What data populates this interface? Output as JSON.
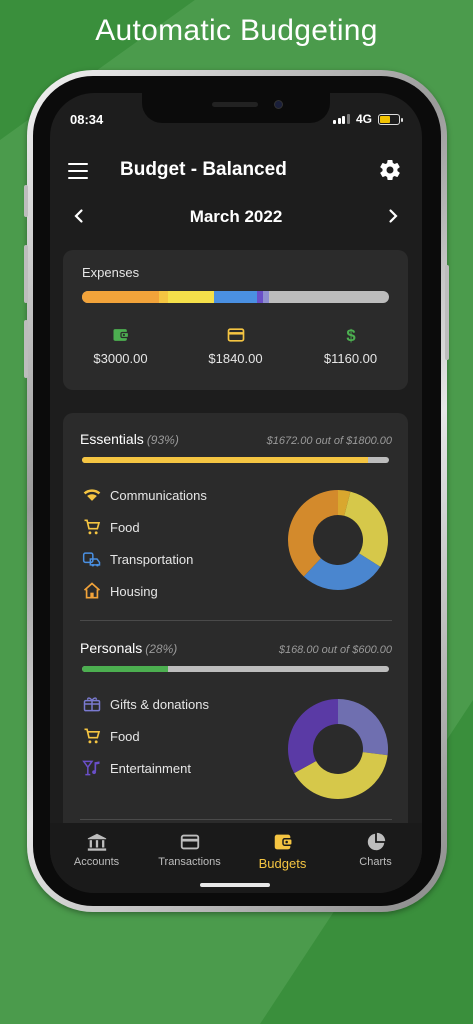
{
  "headline": "Automatic Budgeting",
  "colors": {
    "background": "#3a8f3c",
    "accent": "#f5c542",
    "orange": "#f2a33a",
    "yellow": "#f5d94a",
    "blue": "#4a90e2",
    "purple": "#6a4fc8",
    "green": "#4caf50",
    "gray": "#bdbdbd"
  },
  "status_bar": {
    "time": "08:34",
    "network": "4G"
  },
  "app_bar": {
    "menu_icon": "menu-icon",
    "title": "Budget - Balanced",
    "settings_icon": "gear-icon"
  },
  "month_nav": {
    "prev_icon": "chevron-left-icon",
    "title": "March 2022",
    "next_icon": "chevron-right-icon"
  },
  "expenses": {
    "title": "Expenses",
    "bar_segments": [
      {
        "color": "#f2a33a",
        "fraction": 0.25
      },
      {
        "color": "#f5c542",
        "fraction": 0.03
      },
      {
        "color": "#f5e04a",
        "fraction": 0.15
      },
      {
        "color": "#4a90e2",
        "fraction": 0.14
      },
      {
        "color": "#6a4fc8",
        "fraction": 0.02
      },
      {
        "color": "#8f8fd0",
        "fraction": 0.02
      }
    ],
    "stats": [
      {
        "icon": "wallet-icon",
        "color": "#4caf50",
        "value": "$3000.00"
      },
      {
        "icon": "credit-card-icon",
        "color": "#f5c542",
        "value": "$1840.00"
      },
      {
        "icon": "dollar-icon",
        "color": "#4caf50",
        "value": "$1160.00"
      }
    ]
  },
  "budgets": [
    {
      "name": "Essentials",
      "percent": "(93%)",
      "amount": "$1672.00 out of $1800.00",
      "progress": 0.93,
      "bar_color": "#f5c542",
      "categories": [
        {
          "icon": "wifi-icon",
          "color": "#f5c542",
          "label": "Communications"
        },
        {
          "icon": "cart-icon",
          "color": "#f5c542",
          "label": "Food"
        },
        {
          "icon": "transportation-icon",
          "color": "#4a90e2",
          "label": "Transportation"
        },
        {
          "icon": "house-icon",
          "color": "#f2a33a",
          "label": "Housing"
        }
      ],
      "chart_data": {
        "type": "pie",
        "slices": [
          {
            "color": "#d9a72e",
            "value": 4
          },
          {
            "color": "#d6c84a",
            "value": 30
          },
          {
            "color": "#4a86cf",
            "value": 28
          },
          {
            "color": "#d38a2c",
            "value": 38
          }
        ]
      }
    },
    {
      "name": "Personals",
      "percent": "(28%)",
      "amount": "$168.00 out of $600.00",
      "progress": 0.28,
      "bar_color": "#4caf50",
      "categories": [
        {
          "icon": "gift-icon",
          "color": "#7a7ad0",
          "label": "Gifts & donations"
        },
        {
          "icon": "cart-icon",
          "color": "#f5c542",
          "label": "Food"
        },
        {
          "icon": "entertainment-icon",
          "color": "#6a4fc8",
          "label": "Entertainment"
        }
      ],
      "chart_data": {
        "type": "pie",
        "slices": [
          {
            "color": "#6f6fb0",
            "value": 27
          },
          {
            "color": "#d6c84a",
            "value": 40
          },
          {
            "color": "#5a3aa5",
            "value": 33
          }
        ]
      }
    }
  ],
  "bottom_nav": [
    {
      "icon": "bank-icon",
      "label": "Accounts",
      "active": false
    },
    {
      "icon": "credit-card-icon",
      "label": "Transactions",
      "active": false
    },
    {
      "icon": "wallet-icon",
      "label": "Budgets",
      "active": true
    },
    {
      "icon": "pie-chart-icon",
      "label": "Charts",
      "active": false
    }
  ]
}
